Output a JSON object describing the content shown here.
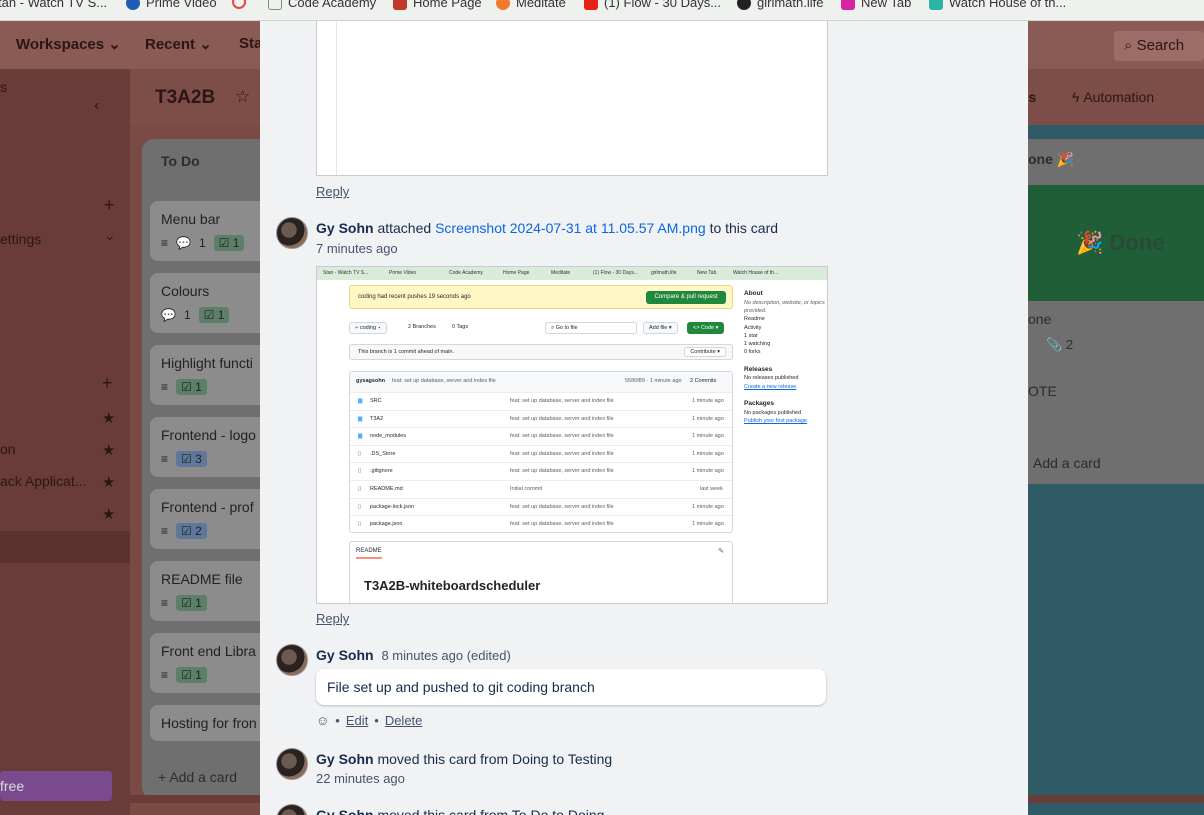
{
  "bookmarks": [
    {
      "label": "tan - Watch TV S...",
      "color": "#2b73d9"
    },
    {
      "label": "Prime Video",
      "color": "#1e5bb5"
    },
    {
      "label": "",
      "color": "#e04b3c"
    },
    {
      "label": "Code Academy",
      "color": "#888888"
    },
    {
      "label": "Home Page",
      "color": "#c0392b"
    },
    {
      "label": "Meditate",
      "color": "#f07b2a"
    },
    {
      "label": "(1) Flow - 30 Days...",
      "color": "#e62117"
    },
    {
      "label": "girlmath.life",
      "color": "#222222"
    },
    {
      "label": "New Tab",
      "color": "#d6249f"
    },
    {
      "label": "Watch House of th...",
      "color": "#2ab5a5"
    }
  ],
  "topnav": {
    "workspaces": "Workspaces",
    "recent": "Recent",
    "starred": "Sta",
    "search": "Search"
  },
  "sidebar": {
    "top_label": "s",
    "settings": "ettings",
    "items": [
      "on",
      "ack Applicat..."
    ],
    "free": "free"
  },
  "board": {
    "title": "T3A2B",
    "automation": "Automation",
    "ops": "ps",
    "list_title": "To Do",
    "add_card": "Add a card",
    "cards": [
      {
        "title": "Menu bar",
        "comments": "1",
        "checklist": "1"
      },
      {
        "title": "Colours",
        "comments": "1",
        "checklist": "1"
      },
      {
        "title": "Highlight functi",
        "comments": "",
        "checklist": "1"
      },
      {
        "title": "Frontend - logo",
        "comments": "",
        "checklist": "3"
      },
      {
        "title": "Frontend - prof",
        "comments": "",
        "checklist": "2"
      },
      {
        "title": "README file",
        "comments": "",
        "checklist": "1"
      },
      {
        "title": "Front end Libra",
        "comments": "",
        "checklist": "1"
      },
      {
        "title": "Hosting for fron",
        "comments": "",
        "checklist": ""
      }
    ],
    "done_list_title": "one 🎉",
    "done_cover": "🎉 Done",
    "done_card_title": "one",
    "done_card_attach": "2",
    "note_card": "OTE",
    "right_add_card": "Add a card"
  },
  "modal": {
    "reply1": "Reply",
    "attach_activity": {
      "user": "Gy Sohn",
      "verb": "attached",
      "file": "Screenshot 2024-07-31 at 11.05.57 AM.png",
      "suffix": "to this card",
      "time": "7 minutes ago"
    },
    "reply2": "Reply",
    "comment": {
      "user": "Gy Sohn",
      "time": "8 minutes ago (edited)",
      "text": "File set up and pushed to git coding branch",
      "edit": "Edit",
      "delete": "Delete"
    },
    "move1": {
      "user": "Gy Sohn",
      "text": "moved this card from Doing to Testing",
      "time": "22 minutes ago"
    },
    "move2": {
      "user": "Gy Sohn",
      "text": "moved this card from To Do to Doing"
    }
  },
  "screenshot": {
    "bookmarks": [
      "Stan - Watch TV S...",
      "Prime Video",
      "Code Academy",
      "Home Page",
      "Meditate",
      "(1) Flow - 30 Days...",
      "girlmath.life",
      "New Tab",
      "Watch House of th..."
    ],
    "banner": "coding had recent pushes 19 seconds ago",
    "compare_btn": "Compare & pull request",
    "branch": "coding",
    "branches": "2 Branches",
    "tags": "0 Tags",
    "goto": "Go to file",
    "add_file": "Add file",
    "code_btn": "Code",
    "ahead": "This branch is 1 commit ahead of main.",
    "contribute": "Contribute",
    "commit_user": "gysagsohn",
    "commit_msg": "feat: set up database, server and index file",
    "commit_meta": "5586f89 · 1 minute ago",
    "commits": "2 Commits",
    "files": [
      {
        "name": "SRC",
        "msg": "feat: set up database, server and index file",
        "time": "1 minute ago"
      },
      {
        "name": "T3A2",
        "msg": "feat: set up database, server and index file",
        "time": "1 minute ago"
      },
      {
        "name": "node_modules",
        "msg": "feat: set up database, server and index file",
        "time": "1 minute ago"
      },
      {
        "name": ".DS_Store",
        "msg": "feat: set up database, server and index file",
        "time": "1 minute ago"
      },
      {
        "name": ".gitignore",
        "msg": "feat: set up database, server and index file",
        "time": "1 minute ago"
      },
      {
        "name": "README.md",
        "msg": "Initial commit",
        "time": "last week"
      },
      {
        "name": "package-lock.json",
        "msg": "feat: set up database, server and index file",
        "time": "1 minute ago"
      },
      {
        "name": "package.json",
        "msg": "feat: set up database, server and index file",
        "time": "1 minute ago"
      }
    ],
    "readme_tab": "README",
    "readme_title": "T3A2B-whiteboardscheduler",
    "about": "About",
    "about_desc": "No description, website, or topics provided.",
    "about_items": [
      "Readme",
      "Activity",
      "1 star",
      "1 watching",
      "0 forks"
    ],
    "releases": "Releases",
    "no_releases": "No releases published",
    "create_release": "Create a new release",
    "packages": "Packages",
    "no_packages": "No packages published",
    "publish_package": "Publish your first package"
  }
}
